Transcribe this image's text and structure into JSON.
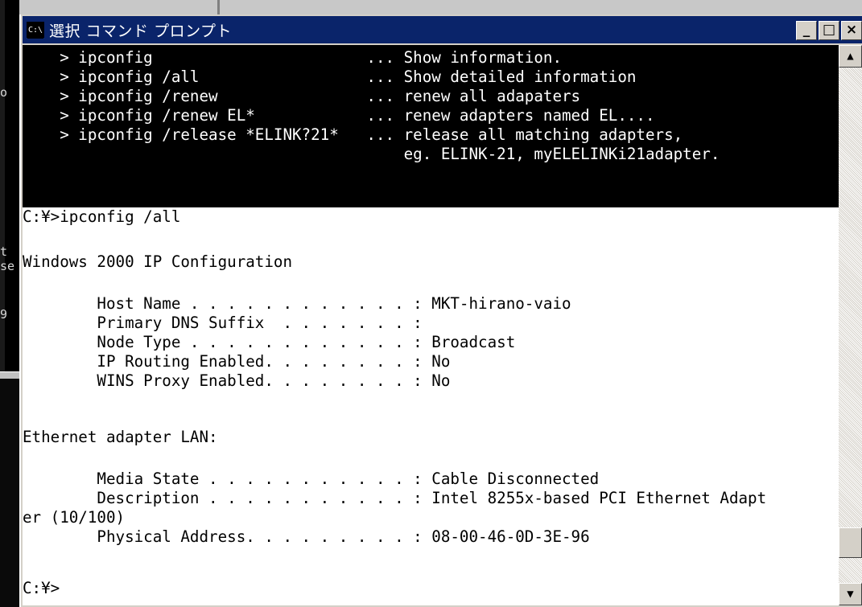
{
  "window": {
    "title": "選択 コマンド プロンプト",
    "icon_label": "C:\\",
    "minimize": "_",
    "maximize": "□",
    "close": "×"
  },
  "background_window": {
    "fragments": [
      "o",
      "t",
      "se",
      "9"
    ]
  },
  "console": {
    "help_lines": [
      "    > ipconfig                       ... Show information.",
      "    > ipconfig /all                  ... Show detailed information",
      "    > ipconfig /renew                ... renew all adapaters",
      "    > ipconfig /renew EL*            ... renew adapters named EL....",
      "    > ipconfig /release *ELINK?21*   ... release all matching adapters,",
      "                                         eg. ELINK-21, myELELINKi21adapter."
    ],
    "output_lines": [
      "C:¥>ipconfig /all",
      "",
      "Windows 2000 IP Configuration",
      "",
      "        Host Name . . . . . . . . . . . . : MKT-hirano-vaio",
      "        Primary DNS Suffix  . . . . . . . :",
      "        Node Type . . . . . . . . . . . . : Broadcast",
      "        IP Routing Enabled. . . . . . . . : No",
      "        WINS Proxy Enabled. . . . . . . . : No",
      "",
      "Ethernet adapter LAN:",
      "",
      "        Media State . . . . . . . . . . . : Cable Disconnected",
      "        Description . . . . . . . . . . . : Intel 8255x-based PCI Ethernet Adapt",
      "er (10/100)",
      "        Physical Address. . . . . . . . . : 08-00-46-0D-3E-96",
      "",
      "C:¥>"
    ]
  },
  "scrollbar": {
    "up_arrow": "▲",
    "down_arrow": "▼"
  }
}
